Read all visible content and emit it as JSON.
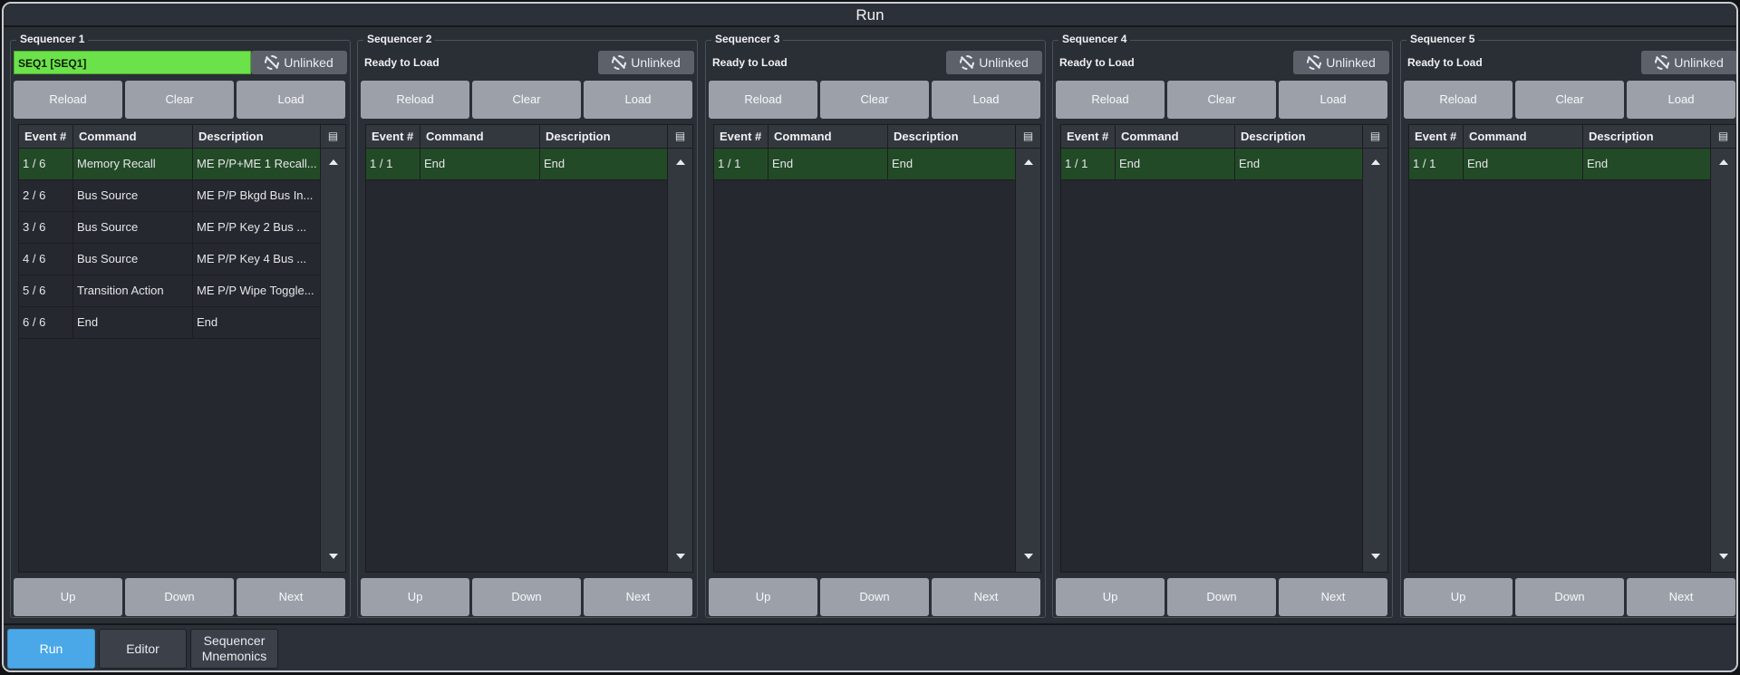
{
  "window": {
    "title": "Run"
  },
  "common": {
    "unlinked_label": "Unlinked",
    "reload_label": "Reload",
    "clear_label": "Clear",
    "load_label": "Load",
    "up_label": "Up",
    "down_label": "Down",
    "next_label": "Next",
    "columns": [
      "Event #",
      "Command",
      "Description"
    ],
    "table_menu_icon": "table-settings-icon",
    "loaded_color": "#6be24a",
    "active_row_color": "#234a27"
  },
  "sequencers": [
    {
      "title": "Sequencer 1",
      "status": "SEQ1 [SEQ1]",
      "loaded": true,
      "rows": [
        {
          "event": "1 / 6",
          "command": "Memory Recall",
          "description": "ME P/P+ME 1 Recall...",
          "active": true
        },
        {
          "event": "2 / 6",
          "command": "Bus Source",
          "description": "ME P/P Bkgd Bus In...",
          "active": false
        },
        {
          "event": "3 / 6",
          "command": "Bus Source",
          "description": "ME P/P Key 2 Bus ...",
          "active": false
        },
        {
          "event": "4 / 6",
          "command": "Bus Source",
          "description": "ME P/P Key 4 Bus ...",
          "active": false
        },
        {
          "event": "5 / 6",
          "command": "Transition Action",
          "description": "ME P/P Wipe Toggle...",
          "active": false
        },
        {
          "event": "6 / 6",
          "command": "End",
          "description": "End",
          "active": false
        }
      ]
    },
    {
      "title": "Sequencer 2",
      "status": "Ready to Load",
      "loaded": false,
      "rows": [
        {
          "event": "1 / 1",
          "command": "End",
          "description": "End",
          "active": true
        }
      ]
    },
    {
      "title": "Sequencer 3",
      "status": "Ready to Load",
      "loaded": false,
      "rows": [
        {
          "event": "1 / 1",
          "command": "End",
          "description": "End",
          "active": true
        }
      ]
    },
    {
      "title": "Sequencer 4",
      "status": "Ready to Load",
      "loaded": false,
      "rows": [
        {
          "event": "1 / 1",
          "command": "End",
          "description": "End",
          "active": true
        }
      ]
    },
    {
      "title": "Sequencer 5",
      "status": "Ready to Load",
      "loaded": false,
      "rows": [
        {
          "event": "1 / 1",
          "command": "End",
          "description": "End",
          "active": true
        }
      ]
    }
  ],
  "tabs": [
    {
      "label": "Run",
      "active": true
    },
    {
      "label": "Editor",
      "active": false
    },
    {
      "label": "Sequencer\nMnemonics",
      "active": false
    }
  ],
  "accent_color": "#4aa8e8"
}
